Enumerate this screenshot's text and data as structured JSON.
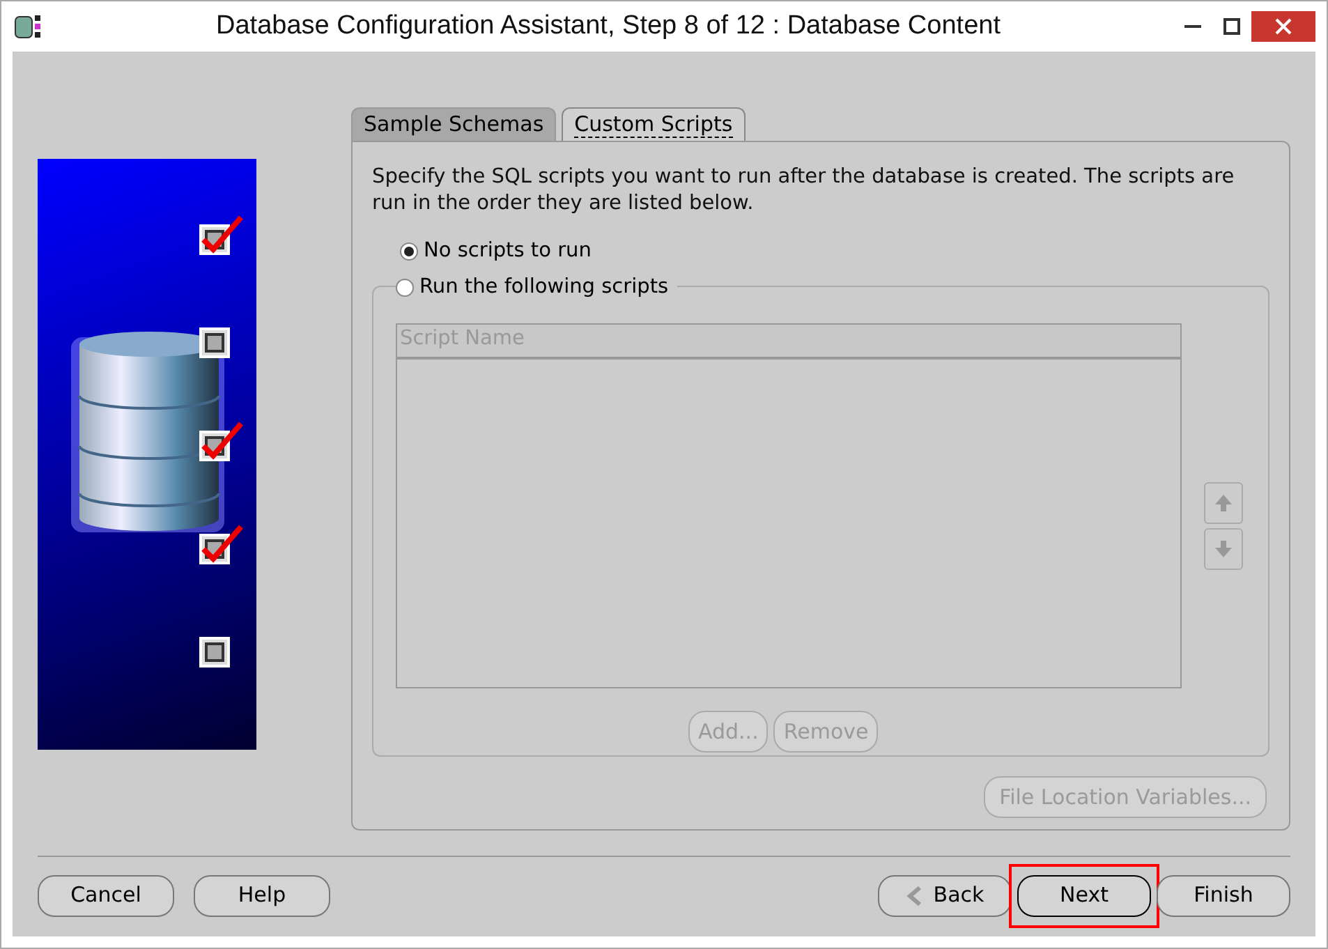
{
  "window": {
    "title": "Database Configuration Assistant, Step 8 of 12 : Database Content"
  },
  "progress_marks": [
    {
      "checked": true
    },
    {
      "checked": false
    },
    {
      "checked": true
    },
    {
      "checked": true
    },
    {
      "checked": false
    }
  ],
  "tabs": [
    {
      "label": "Sample Schemas",
      "selected": false
    },
    {
      "label": "Custom Scripts",
      "selected": true
    }
  ],
  "description": "Specify the SQL scripts you want to run after the database is created. The scripts are run in the order they are listed below.",
  "options": [
    {
      "label": "No scripts to run",
      "selected": true
    },
    {
      "label": "Run the following scripts",
      "selected": false
    }
  ],
  "table": {
    "columns": [
      "Script Name"
    ]
  },
  "list_buttons": [
    {
      "label": "Add...",
      "disabled": true
    },
    {
      "label": "Remove",
      "disabled": true
    }
  ],
  "file_location_button": {
    "label": "File Location Variables...",
    "disabled": true
  },
  "left_buttons": [
    {
      "label": "Cancel"
    },
    {
      "label": "Help"
    }
  ],
  "nav_buttons": [
    {
      "label": "Back",
      "kind": "back",
      "highlighted": false
    },
    {
      "label": "Next",
      "kind": "next",
      "highlighted": true
    },
    {
      "label": "Finish",
      "kind": "finish",
      "highlighted": false
    }
  ]
}
